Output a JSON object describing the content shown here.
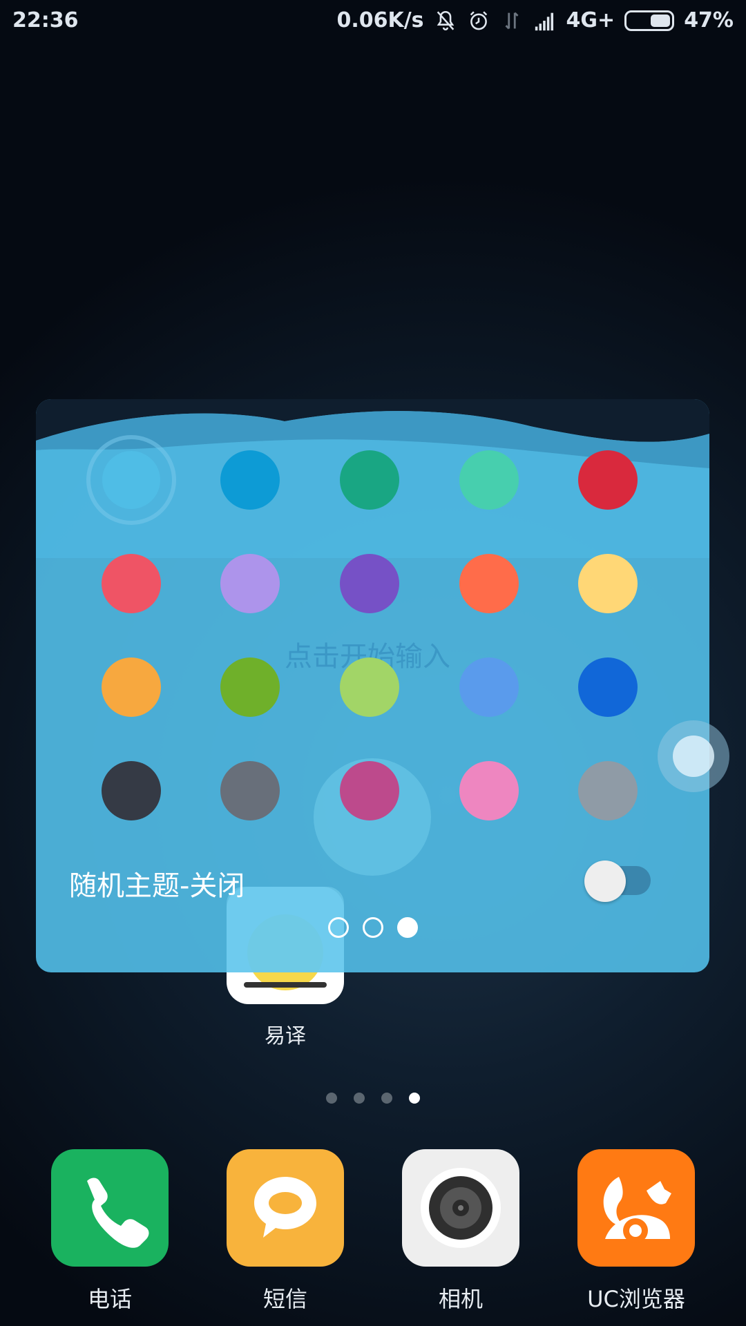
{
  "status_bar": {
    "time": "22:36",
    "net_speed": "0.06K/s",
    "network": "4G+",
    "battery_percent": "47%",
    "battery_level": 0.47,
    "icons": [
      "mute-icon",
      "alarm-icon",
      "data-transfer-icon",
      "signal-icon",
      "battery-icon"
    ]
  },
  "background_app": {
    "label": "易译",
    "icon": "pikachu-sticker-icon"
  },
  "home_pages": {
    "count": 4,
    "current": 4
  },
  "dock": [
    {
      "label": "电话",
      "icon": "phone-icon",
      "color": "#1ab25f"
    },
    {
      "label": "短信",
      "icon": "message-icon",
      "color": "#f8b33c"
    },
    {
      "label": "相机",
      "icon": "camera-icon",
      "color": "#eeeeee"
    },
    {
      "label": "UC浏览器",
      "icon": "uc-squirrel-icon",
      "color": "#ff7a13"
    }
  ],
  "theme_panel": {
    "ghost_placeholder": "点击开始输入",
    "selected_index": 0,
    "colors": [
      "#4fbde6",
      "#0d9bd5",
      "#19a683",
      "#47cfae",
      "#d9293d",
      "#ef5465",
      "#ad94eb",
      "#7651c6",
      "#ff6c4a",
      "#ffd776",
      "#f7a83f",
      "#6fb02a",
      "#a2d567",
      "#5a9bec",
      "#1167d8",
      "#353a45",
      "#686f7a",
      "#bd4a8c",
      "#ee86c0",
      "#8f9ba6"
    ],
    "random_theme_label": "随机主题-关闭",
    "random_theme_on": false,
    "pages": {
      "count": 3,
      "current": 3
    }
  }
}
